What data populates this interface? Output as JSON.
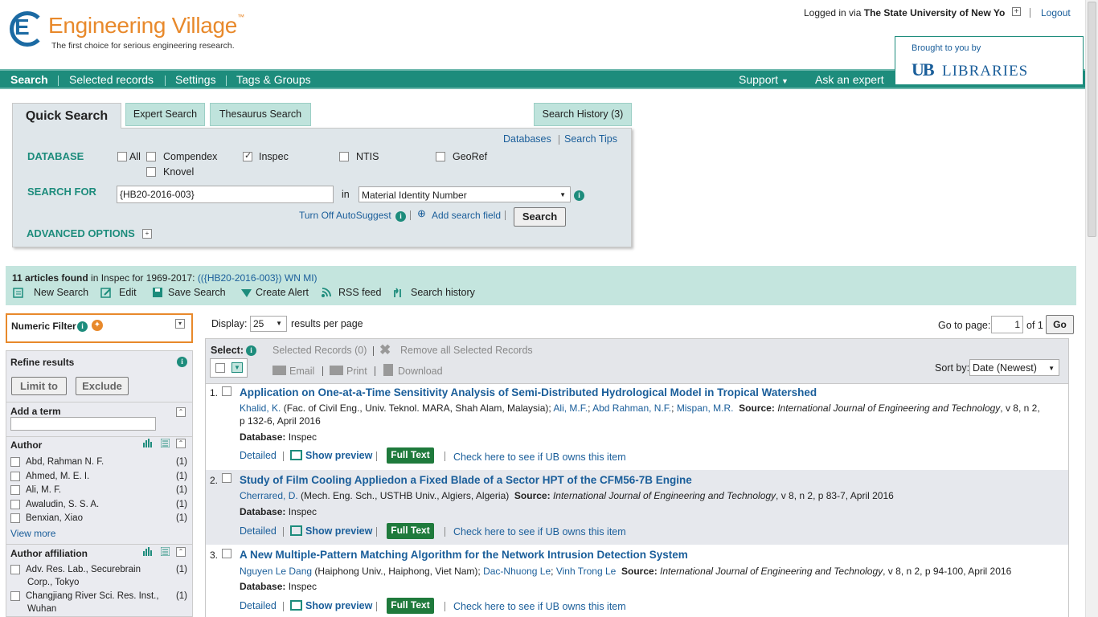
{
  "header": {
    "logo_text": "Engineering Village",
    "logo_tm": "™",
    "tagline": "The first choice for serious engineering research.",
    "login_prefix": "Logged in via",
    "login_institution": "The State University of New Yo",
    "logout": "Logout",
    "brought_by": "Brought to you by",
    "ub_mark": "UB",
    "libraries": "LIBRARIES"
  },
  "nav": {
    "search": "Search",
    "selected_records": "Selected records",
    "settings": "Settings",
    "tags_groups": "Tags & Groups",
    "support": "Support",
    "ask_expert": "Ask an expert"
  },
  "search": {
    "tabs": {
      "quick": "Quick Search",
      "expert": "Expert Search",
      "thesaurus": "Thesaurus Search",
      "history": "Search History (3)"
    },
    "databases_link": "Databases",
    "tips_link": "Search Tips",
    "database_label": "DATABASE",
    "db_options": {
      "all": "All",
      "compendex": "Compendex",
      "inspec": "Inspec",
      "ntis": "NTIS",
      "georef": "GeoRef",
      "knovel": "Knovel"
    },
    "search_for_label": "SEARCH FOR",
    "query": "{HB20-2016-003}",
    "in_label": "in",
    "field": "Material Identity Number",
    "autosuggest": "Turn Off AutoSuggest",
    "add_field": "Add search field",
    "search_button": "Search",
    "advanced": "ADVANCED OPTIONS"
  },
  "results_header": {
    "count": "11 articles found",
    "scope": "in Inspec for 1969-2017:",
    "query": "(({HB20-2016-003}) WN MI)",
    "actions": {
      "new_search": "New Search",
      "edit": "Edit",
      "save_search": "Save Search",
      "create_alert": "Create Alert",
      "rss": "RSS feed",
      "history": "Search history"
    }
  },
  "sidebar": {
    "numeric_filter": "Numeric Filter",
    "refine": "Refine results",
    "limit_to": "Limit to",
    "exclude": "Exclude",
    "add_term": "Add a term",
    "author_title": "Author",
    "authors": [
      {
        "name": "Abd, Rahman N. F.",
        "count": "(1)"
      },
      {
        "name": "Ahmed, M. E. I.",
        "count": "(1)"
      },
      {
        "name": "Ali, M. F.",
        "count": "(1)"
      },
      {
        "name": "Awaludin, S. S. A.",
        "count": "(1)"
      },
      {
        "name": "Benxian, Xiao",
        "count": "(1)"
      }
    ],
    "view_more": "View more",
    "affil_title": "Author affiliation",
    "affiliations": [
      {
        "line1": "Adv. Res. Lab., Securebrain",
        "line2": "Corp., Tokyo",
        "count": "(1)"
      },
      {
        "line1": "Changjiang River Sci. Res. Inst.,",
        "line2": "Wuhan",
        "count": "(1)"
      }
    ]
  },
  "toolbar": {
    "display_label": "Display:",
    "per_page": "25",
    "per_page_suffix": "results per page",
    "goto_label": "Go to page:",
    "page": "1",
    "of_pages": "of 1",
    "go": "Go",
    "select_label": "Select:",
    "selected_records": "Selected Records (0)",
    "remove_all": "Remove all Selected Records",
    "email": "Email",
    "print": "Print",
    "download": "Download",
    "sort_label": "Sort by:",
    "sort_value": "Date (Newest)"
  },
  "results": [
    {
      "num": "1.",
      "title": "Application on One-at-a-Time Sensitivity Analysis of Semi-Distributed Hydrological Model in Tropical Watershed",
      "author1": "Khalid, K.",
      "affil": "(Fac. of Civil Eng., Univ. Teknol. MARA, Shah Alam, Malaysia);",
      "author2": "Ali, M.F.",
      "author3": "Abd Rahman, N.F.",
      "author4": "Mispan, M.R.",
      "source_label": "Source:",
      "journal": "International Journal of Engineering and Technology",
      "cite": ", v 8, n 2,",
      "cite2": "p 132-6, April 2016",
      "db_label": "Database:",
      "db": "Inspec"
    },
    {
      "num": "2.",
      "title": "Study of Film Cooling Appliedon a Fixed Blade of a Sector HPT of the CFM56-7B Engine",
      "author1": "Cherrared, D.",
      "affil": "(Mech. Eng. Sch., USTHB Univ., Algiers, Algeria)",
      "source_label": "Source:",
      "journal": "International Journal of Engineering and Technology",
      "cite": ", v 8, n 2, p 83-7, April 2016",
      "db_label": "Database:",
      "db": "Inspec"
    },
    {
      "num": "3.",
      "title": "A New Multiple-Pattern Matching Algorithm for the Network Intrusion Detection System",
      "author1": "Nguyen Le Dang",
      "affil": "(Haiphong Univ., Haiphong, Viet Nam);",
      "author2": "Dac-Nhuong Le",
      "author3": "Vinh Trong Le",
      "source_label": "Source:",
      "journal": "International Journal of Engineering and Technology",
      "cite": ", v 8, n 2, p 94-100, April 2016",
      "db_label": "Database:",
      "db": "Inspec"
    }
  ],
  "result_actions": {
    "detailed": "Detailed",
    "show_preview": "Show preview",
    "full_text": "Full Text",
    "check_ub": "Check here to see if UB owns this item"
  },
  "colors": {
    "brand_green": "#1d8c7c",
    "link_blue": "#1a5e9a",
    "logo_orange": "#e8892b",
    "fulltext_green": "#1f7a3c"
  }
}
